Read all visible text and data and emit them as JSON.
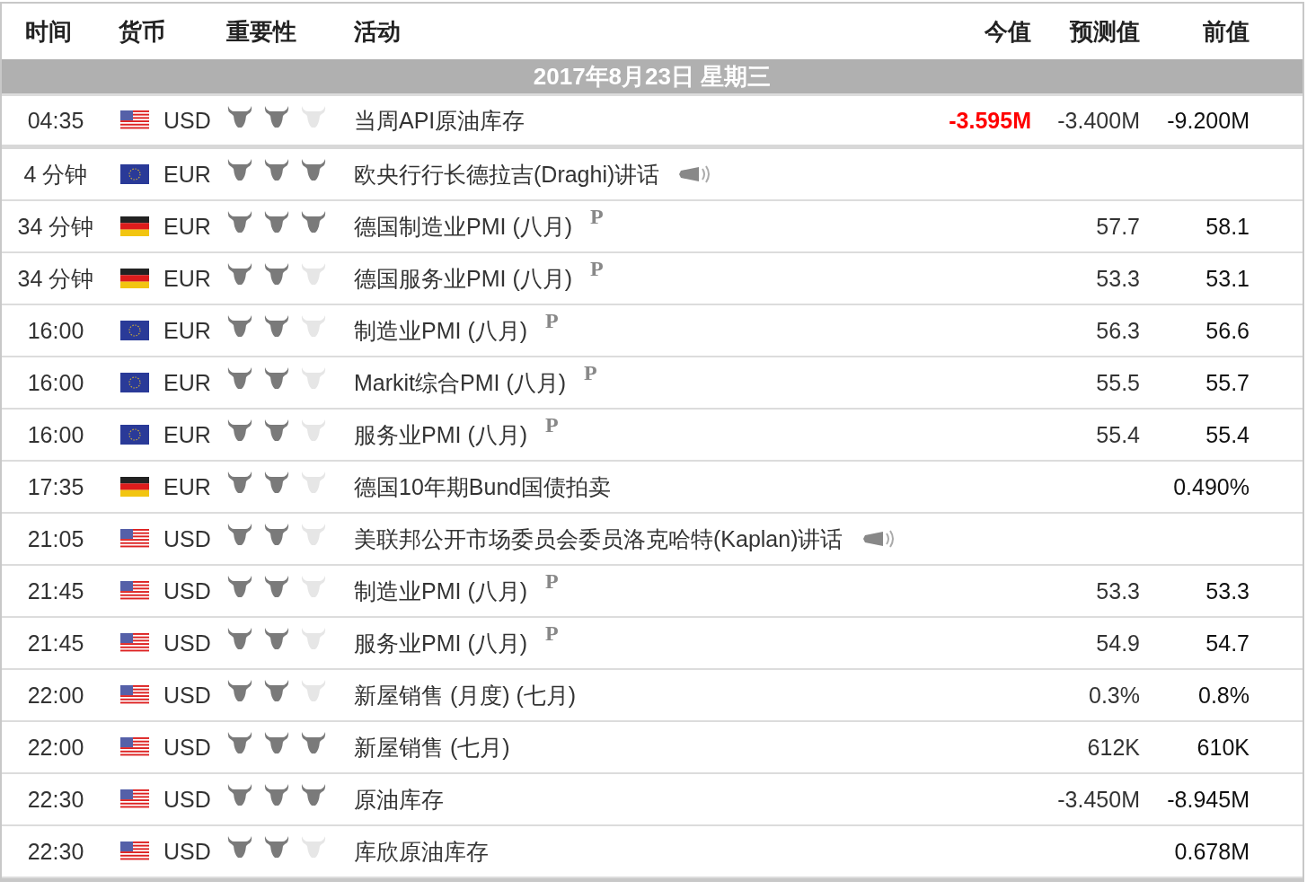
{
  "columns": [
    "时间",
    "货币",
    "重要性",
    "活动",
    "今值",
    "预测值",
    "前值"
  ],
  "date": "2017年8月23日  星期三",
  "rows": [
    {
      "time": "04:35",
      "kind": "us",
      "currency": "USD",
      "stars": 2,
      "event": "当周API原油库存",
      "actual": "-3.595M",
      "actual_highlight": true,
      "forecast": "-3.400M",
      "previous": "-9.200M"
    },
    {
      "time": "4 分钟",
      "kind": "eu",
      "currency": "EUR",
      "stars": 3,
      "event": "欧央行行长德拉吉(Draghi)讲话",
      "speech": true
    },
    {
      "time": "34 分钟",
      "kind": "de",
      "currency": "EUR",
      "stars": 3,
      "event": "德国制造业PMI (八月)",
      "tag": "P",
      "forecast": "57.7",
      "previous": "58.1"
    },
    {
      "time": "34 分钟",
      "kind": "de",
      "currency": "EUR",
      "stars": 2,
      "event": "德国服务业PMI (八月)",
      "tag": "P",
      "forecast": "53.3",
      "previous": "53.1"
    },
    {
      "time": "16:00",
      "kind": "eu",
      "currency": "EUR",
      "stars": 2,
      "event": "制造业PMI (八月)",
      "tag": "P",
      "forecast": "56.3",
      "previous": "56.6"
    },
    {
      "time": "16:00",
      "kind": "eu",
      "currency": "EUR",
      "stars": 2,
      "event": "Markit综合PMI (八月)",
      "tag": "P",
      "forecast": "55.5",
      "previous": "55.7"
    },
    {
      "time": "16:00",
      "kind": "eu",
      "currency": "EUR",
      "stars": 2,
      "event": "服务业PMI (八月)",
      "tag": "P",
      "forecast": "55.4",
      "previous": "55.4"
    },
    {
      "time": "17:35",
      "kind": "de",
      "currency": "EUR",
      "stars": 2,
      "event": "德国10年期Bund国债拍卖",
      "previous": "0.490%"
    },
    {
      "time": "21:05",
      "kind": "us",
      "currency": "USD",
      "stars": 2,
      "event": "美联邦公开市场委员会委员洛克哈特(Kaplan)讲话",
      "speech": true
    },
    {
      "time": "21:45",
      "kind": "us",
      "currency": "USD",
      "stars": 2,
      "event": "制造业PMI (八月)",
      "tag": "P",
      "forecast": "53.3",
      "previous": "53.3"
    },
    {
      "time": "21:45",
      "kind": "us",
      "currency": "USD",
      "stars": 2,
      "event": "服务业PMI (八月)",
      "tag": "P",
      "forecast": "54.9",
      "previous": "54.7"
    },
    {
      "time": "22:00",
      "kind": "us",
      "currency": "USD",
      "stars": 2,
      "event": "新屋销售 (月度) (七月)",
      "forecast": "0.3%",
      "previous": "0.8%"
    },
    {
      "time": "22:00",
      "kind": "us",
      "currency": "USD",
      "stars": 3,
      "event": "新屋销售 (七月)",
      "forecast": "612K",
      "previous": "610K"
    },
    {
      "time": "22:30",
      "kind": "us",
      "currency": "USD",
      "stars": 3,
      "event": "原油库存",
      "forecast": "-3.450M",
      "previous": "-8.945M"
    },
    {
      "time": "22:30",
      "kind": "us",
      "currency": "USD",
      "stars": 2,
      "event": "库欣原油库存",
      "previous": "0.678M"
    }
  ]
}
